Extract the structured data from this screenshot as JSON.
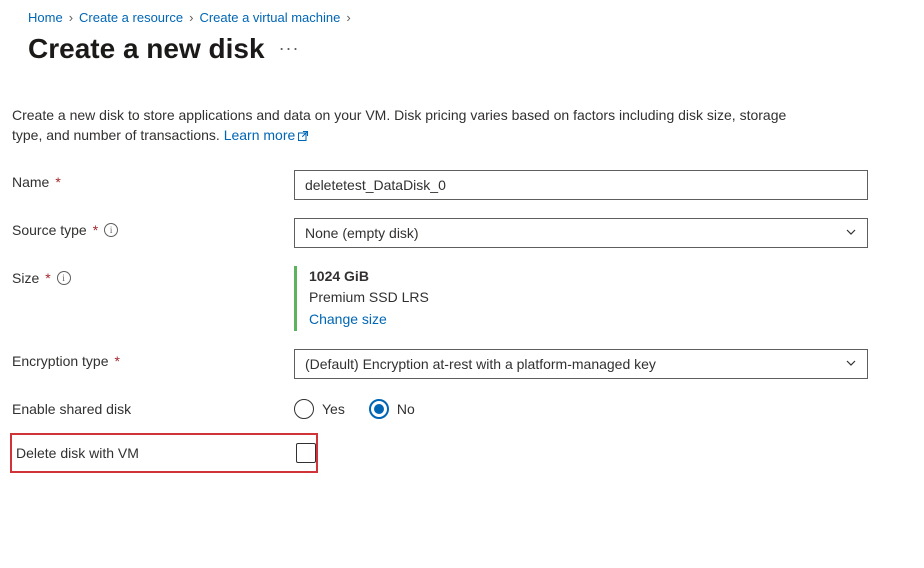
{
  "breadcrumb": {
    "items": [
      {
        "label": "Home"
      },
      {
        "label": "Create a resource"
      },
      {
        "label": "Create a virtual machine"
      }
    ]
  },
  "page": {
    "title": "Create a new disk"
  },
  "intro": {
    "text": "Create a new disk to store applications and data on your VM. Disk pricing varies based on factors including disk size, storage type, and number of transactions. ",
    "learn_more": "Learn more"
  },
  "form": {
    "name": {
      "label": "Name",
      "value": "deletetest_DataDisk_0"
    },
    "source_type": {
      "label": "Source type",
      "value": "None (empty disk)"
    },
    "size": {
      "label": "Size",
      "value": "1024 GiB",
      "type": "Premium SSD LRS",
      "change": "Change size"
    },
    "encryption_type": {
      "label": "Encryption type",
      "value": "(Default) Encryption at-rest with a platform-managed key"
    },
    "enable_shared_disk": {
      "label": "Enable shared disk",
      "yes": "Yes",
      "no": "No",
      "selected": "no"
    },
    "delete_with_vm": {
      "label": "Delete disk with VM",
      "checked": false
    }
  }
}
